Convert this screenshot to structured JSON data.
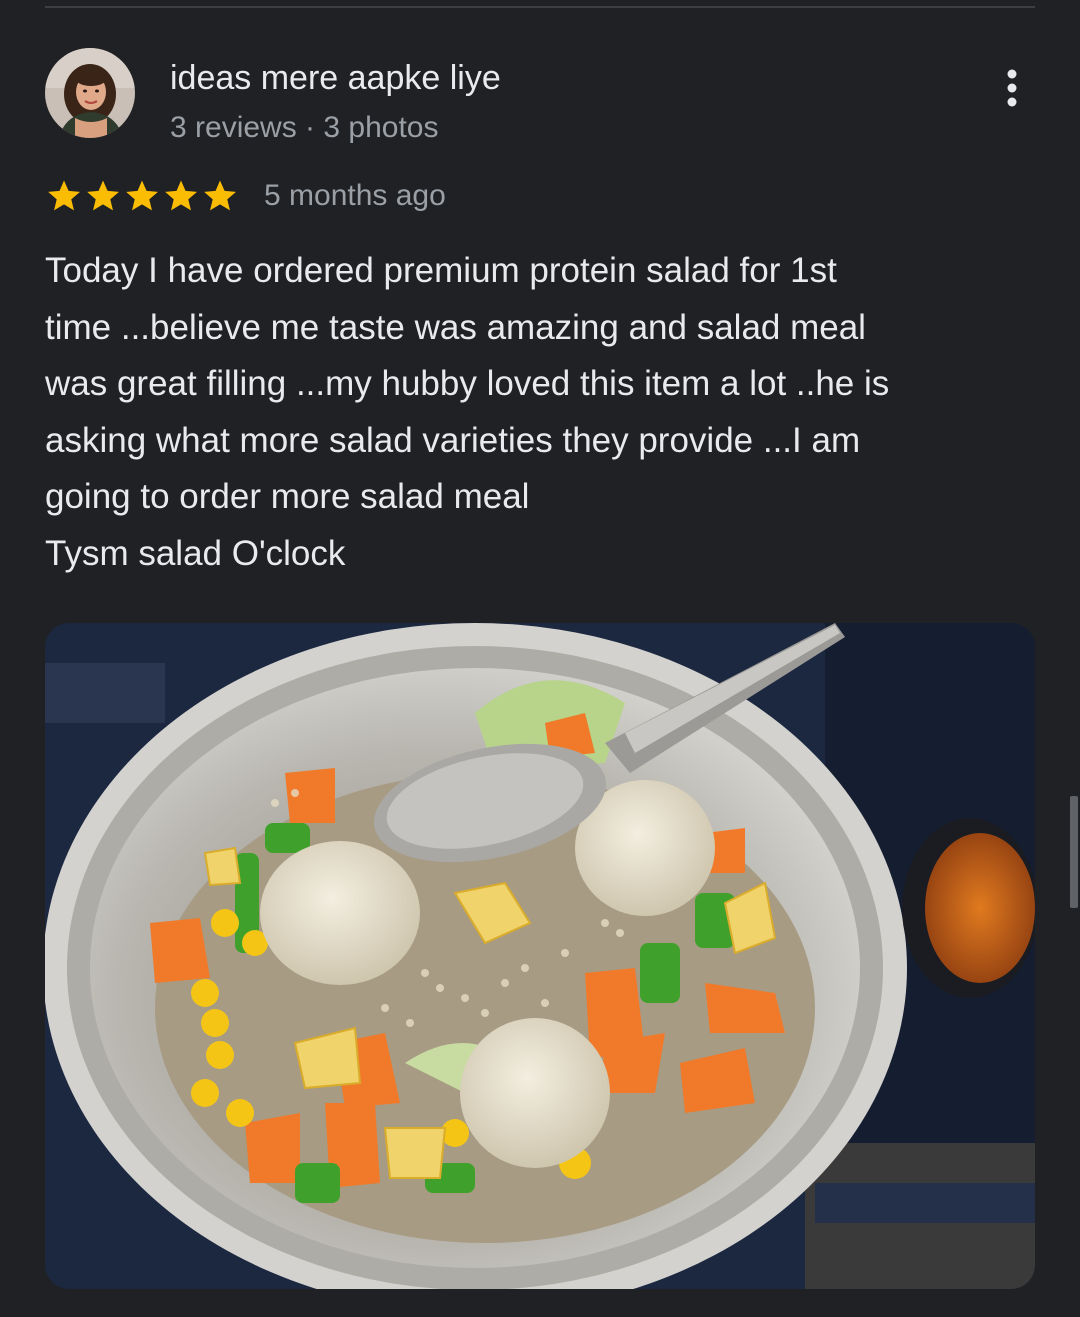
{
  "review": {
    "reviewer_name": "ideas mere aapke liye",
    "reviewer_meta": "3 reviews · 3 photos",
    "rating": 5,
    "rating_max": 5,
    "date": "5 months ago",
    "text_lines": [
      "Today I have ordered premium protein salad for 1st",
      "time ...believe me taste was amazing and salad meal",
      "was great filling ...my hubby loved this item a lot ..he is",
      "asking what more salad varieties they provide ...I am",
      "going to order more salad meal",
      "Tysm salad O'clock"
    ]
  },
  "icons": {
    "more": "more-vert-icon",
    "star": "star-icon",
    "avatar": "reviewer-avatar"
  },
  "colors": {
    "background": "#202124",
    "primary_text": "#e8eaed",
    "secondary_text": "#9aa0a6",
    "star": "#fbbc04",
    "divider": "#3c4043"
  }
}
